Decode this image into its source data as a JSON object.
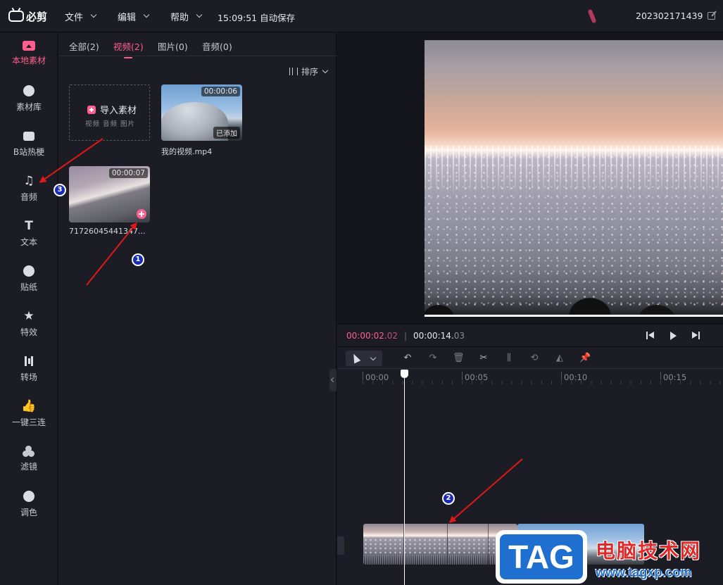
{
  "topbar": {
    "app_name": "必剪",
    "menus": [
      {
        "label": "文件"
      },
      {
        "label": "编辑"
      },
      {
        "label": "帮助"
      }
    ],
    "autosave_text": "15:09:51 自动保存",
    "project_id": "202302171439"
  },
  "sidebar": {
    "items": [
      {
        "label": "本地素材",
        "icon": "upload-icon"
      },
      {
        "label": "素材库",
        "icon": "library-icon"
      },
      {
        "label": "B站热梗",
        "icon": "bilibili-tv-icon"
      },
      {
        "label": "音频",
        "icon": "music-note-icon"
      },
      {
        "label": "文本",
        "icon": "text-t-icon"
      },
      {
        "label": "贴纸",
        "icon": "sticker-icon"
      },
      {
        "label": "特效",
        "icon": "effect-star-icon"
      },
      {
        "label": "转场",
        "icon": "transition-icon"
      },
      {
        "label": "一键三连",
        "icon": "thumbs-up-icon"
      },
      {
        "label": "滤镜",
        "icon": "filter-icon"
      },
      {
        "label": "调色",
        "icon": "palette-icon"
      }
    ],
    "active_index": 0
  },
  "media": {
    "tabs": [
      {
        "label": "全部(2)"
      },
      {
        "label": "视频(2)"
      },
      {
        "label": "图片(0)"
      },
      {
        "label": "音频(0)"
      }
    ],
    "active_tab": 1,
    "sort_label": "排序",
    "import": {
      "title": "导入素材",
      "subtitle": "视频 音频 图片"
    },
    "items": [
      {
        "duration": "00:00:06",
        "badge": "已添加",
        "name": "我的视频.mp4"
      },
      {
        "duration": "00:00:07",
        "name": "71726045441347..."
      }
    ]
  },
  "player": {
    "current_main": "00:00:02.",
    "current_frac": "02",
    "separator": "|",
    "total_main": "00:00:14.",
    "total_frac": "03"
  },
  "timeline": {
    "ticks": [
      "00:00",
      "00:05",
      "00:10",
      "00:15"
    ]
  },
  "annotations": {
    "badges": [
      "1",
      "2",
      "3"
    ],
    "arrow_color": "#e01818"
  },
  "watermark": {
    "tag": "TAG",
    "cn": "电脑技术网",
    "url": "www.tagxp.com"
  },
  "colors": {
    "accent": "#ff5f8e",
    "bg": "#1c1d24"
  }
}
